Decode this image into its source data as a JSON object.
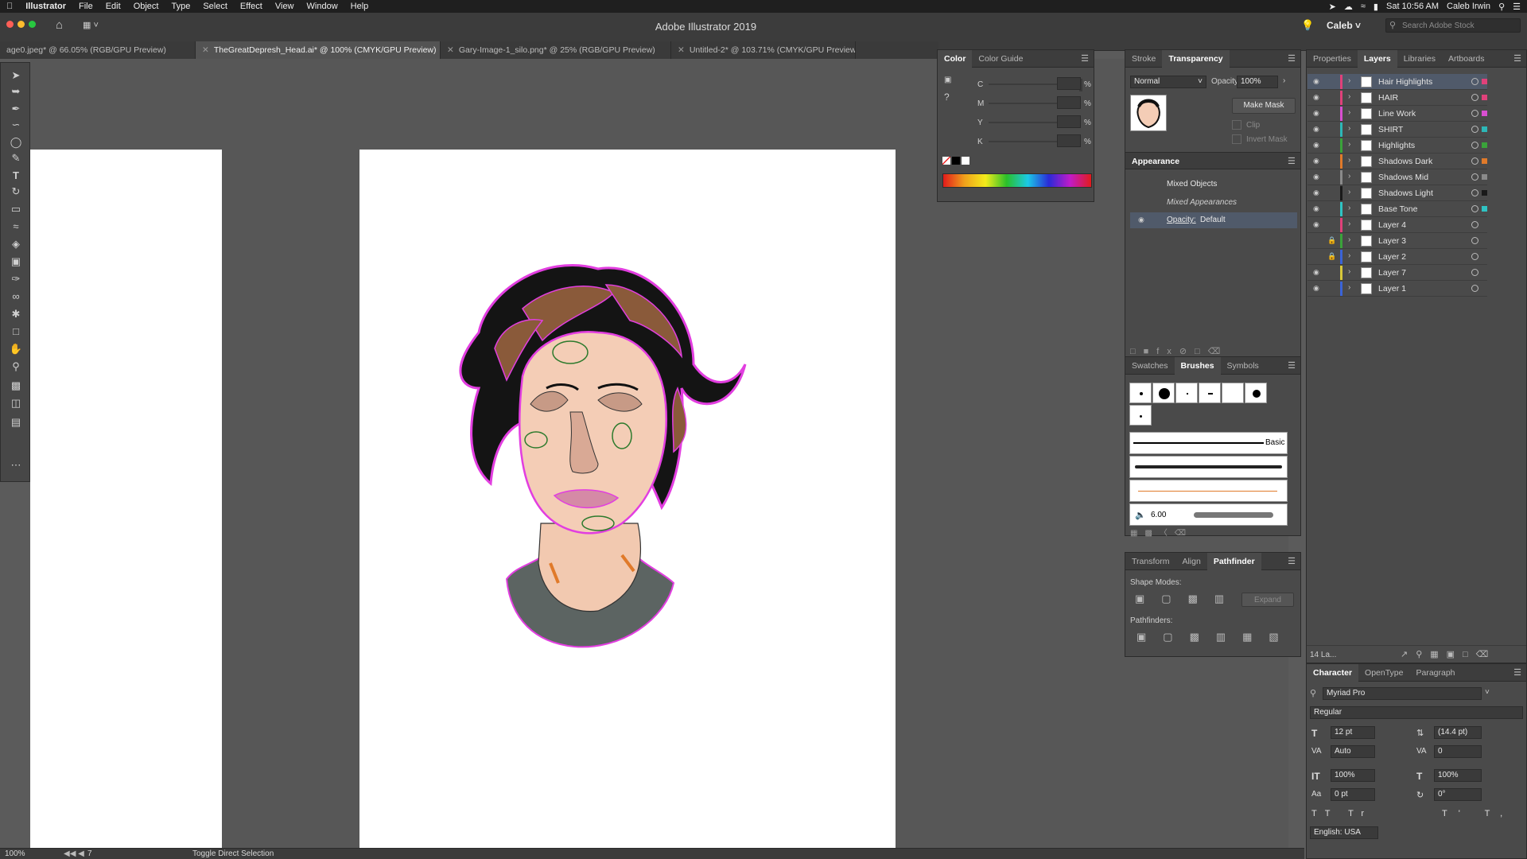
{
  "menubar": {
    "app": "Illustrator",
    "items": [
      "File",
      "Edit",
      "Object",
      "Type",
      "Select",
      "Effect",
      "View",
      "Window",
      "Help"
    ],
    "clock": "Sat 10:56 AM",
    "user": "Caleb Irwin"
  },
  "appbar": {
    "title": "Adobe Illustrator 2019",
    "workspace_user": "Caleb",
    "search_placeholder": "Search Adobe Stock"
  },
  "tabs": [
    {
      "label": "age0.jpeg* @ 66.05% (RGB/GPU Preview)",
      "active": false
    },
    {
      "label": "TheGreatDepresh_Head.ai* @ 100% (CMYK/GPU Preview)",
      "active": true
    },
    {
      "label": "Gary-Image-1_silo.png* @ 25% (RGB/GPU Preview)",
      "active": false
    },
    {
      "label": "Untitled-2* @ 103.71% (CMYK/GPU Preview)",
      "active": false
    }
  ],
  "color_panel": {
    "tabs": [
      "Color",
      "Color Guide"
    ],
    "channels": [
      {
        "label": "C",
        "value": "",
        "unit": "%"
      },
      {
        "label": "M",
        "value": "",
        "unit": "%"
      },
      {
        "label": "Y",
        "value": "",
        "unit": "%"
      },
      {
        "label": "K",
        "value": "",
        "unit": "%"
      }
    ]
  },
  "transparency_panel": {
    "tabs": [
      "Stroke",
      "Transparency"
    ],
    "blend_mode": "Normal",
    "opacity_label": "Opacity:",
    "opacity_value": "100%",
    "make_mask": "Make Mask",
    "clip": "Clip",
    "invert_mask": "Invert Mask"
  },
  "appearance_panel": {
    "title": "Appearance",
    "header": "Mixed Objects",
    "row1": "Mixed Appearances",
    "row2_label": "Opacity:",
    "row2_value": "Default"
  },
  "brushes_panel": {
    "tabs": [
      "Swatches",
      "Brushes",
      "Symbols"
    ],
    "basic_label": "Basic",
    "size_value": "6.00"
  },
  "pathfinder_panel": {
    "tabs": [
      "Transform",
      "Align",
      "Pathfinder"
    ],
    "shape_modes": "Shape Modes:",
    "expand": "Expand",
    "pathfinders": "Pathfinders:"
  },
  "layers_panel": {
    "tabs": [
      "Properties",
      "Layers",
      "Libraries",
      "Artboards"
    ],
    "layers": [
      {
        "name": "Hair Highlights",
        "color": "#e0417a",
        "selected": true,
        "locked": false
      },
      {
        "name": "HAIR",
        "color": "#e0417a",
        "selected": false,
        "locked": false
      },
      {
        "name": "Line Work",
        "color": "#d94fd1",
        "selected": false,
        "locked": false
      },
      {
        "name": "SHIRT",
        "color": "#2db7b7",
        "selected": false,
        "locked": false
      },
      {
        "name": "Highlights",
        "color": "#3aa33a",
        "selected": false,
        "locked": false
      },
      {
        "name": "Shadows Dark",
        "color": "#e07a2a",
        "selected": false,
        "locked": false
      },
      {
        "name": "Shadows Mid",
        "color": "#8a8a8a",
        "selected": false,
        "locked": false
      },
      {
        "name": "Shadows Light",
        "color": "#1a1a1a",
        "selected": false,
        "locked": false
      },
      {
        "name": "Base Tone",
        "color": "#2fc3c3",
        "selected": false,
        "locked": false
      },
      {
        "name": "Layer 4",
        "color": "#e0417a",
        "selected": false,
        "locked": false
      },
      {
        "name": "Layer 3",
        "color": "#3aa33a",
        "selected": false,
        "locked": true
      },
      {
        "name": "Layer 2",
        "color": "#3a63d8",
        "selected": false,
        "locked": true
      },
      {
        "name": "Layer 7",
        "color": "#d8c83a",
        "selected": false,
        "locked": false
      },
      {
        "name": "Layer 1",
        "color": "#3a63d8",
        "selected": false,
        "locked": false
      }
    ],
    "count": "14 La..."
  },
  "character_panel": {
    "tabs": [
      "Character",
      "OpenType",
      "Paragraph"
    ],
    "font": "Myriad Pro",
    "style": "Regular",
    "size": "12 pt",
    "leading": "(14.4 pt)",
    "kerning": "Auto",
    "tracking": "0",
    "vscale": "100%",
    "hscale": "100%",
    "baseline": "0 pt",
    "rotation": "0°",
    "language": "English: USA"
  },
  "status": {
    "zoom": "100%",
    "artboard": "7",
    "tool": "Toggle Direct Selection"
  }
}
